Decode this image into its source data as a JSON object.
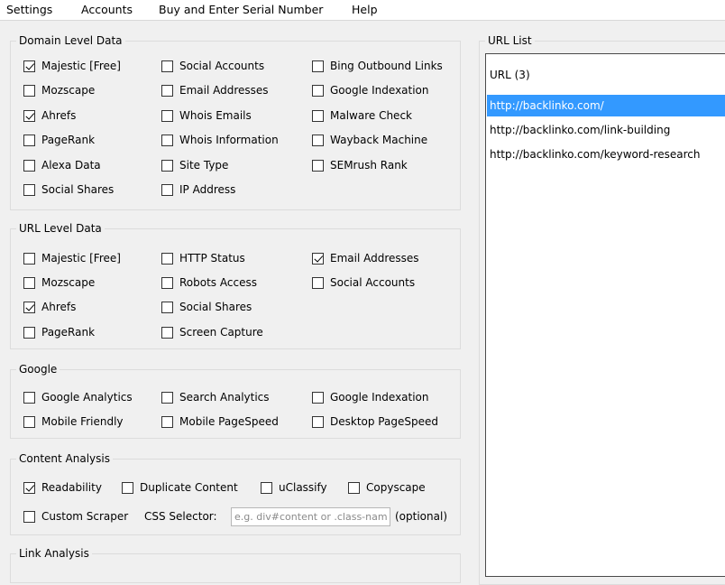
{
  "menu": [
    "Settings",
    "Accounts",
    "Buy and Enter Serial Number",
    "Help"
  ],
  "domain_level": {
    "title": "Domain Level Data",
    "options": [
      {
        "label": "Majestic [Free]",
        "checked": true
      },
      {
        "label": "Mozscape",
        "checked": false
      },
      {
        "label": "Ahrefs",
        "checked": true
      },
      {
        "label": "PageRank",
        "checked": false
      },
      {
        "label": "Alexa Data",
        "checked": false
      },
      {
        "label": "Social Shares",
        "checked": false
      },
      {
        "label": "Social Accounts",
        "checked": false
      },
      {
        "label": "Email Addresses",
        "checked": false
      },
      {
        "label": "Whois Emails",
        "checked": false
      },
      {
        "label": "Whois Information",
        "checked": false
      },
      {
        "label": "Site Type",
        "checked": false
      },
      {
        "label": "IP Address",
        "checked": false
      },
      {
        "label": "Bing Outbound Links",
        "checked": false
      },
      {
        "label": "Google Indexation",
        "checked": false
      },
      {
        "label": "Malware Check",
        "checked": false
      },
      {
        "label": "Wayback Machine",
        "checked": false
      },
      {
        "label": "SEMrush Rank",
        "checked": false
      }
    ]
  },
  "url_level": {
    "title": "URL Level Data",
    "options": [
      {
        "label": "Majestic [Free]",
        "checked": false
      },
      {
        "label": "Mozscape",
        "checked": false
      },
      {
        "label": "Ahrefs",
        "checked": true
      },
      {
        "label": "PageRank",
        "checked": false
      },
      {
        "label": "HTTP Status",
        "checked": false
      },
      {
        "label": "Robots Access",
        "checked": false
      },
      {
        "label": "Social Shares",
        "checked": false
      },
      {
        "label": "Screen Capture",
        "checked": false
      },
      {
        "label": "Email Addresses",
        "checked": true
      },
      {
        "label": "Social Accounts",
        "checked": false
      }
    ]
  },
  "google": {
    "title": "Google",
    "options": [
      {
        "label": "Google Analytics",
        "checked": false
      },
      {
        "label": "Mobile Friendly",
        "checked": false
      },
      {
        "label": "Search Analytics",
        "checked": false
      },
      {
        "label": "Mobile PageSpeed",
        "checked": false
      },
      {
        "label": "Google Indexation",
        "checked": false
      },
      {
        "label": "Desktop PageSpeed",
        "checked": false
      }
    ]
  },
  "content_analysis": {
    "title": "Content Analysis",
    "options": [
      {
        "label": "Readability",
        "checked": true
      },
      {
        "label": "Duplicate Content",
        "checked": false
      },
      {
        "label": "uClassify",
        "checked": false
      },
      {
        "label": "Copyscape",
        "checked": false
      },
      {
        "label": "Custom Scraper",
        "checked": false
      }
    ],
    "css_selector_label": "CSS Selector:",
    "css_selector_placeholder": "e.g. div#content or .class-name",
    "css_selector_value": "",
    "optional_label": "(optional)"
  },
  "link_analysis": {
    "title": "Link Analysis"
  },
  "url_list": {
    "title": "URL List",
    "header": "URL (3)",
    "selected_index": 0,
    "urls": [
      "http://backlinko.com/",
      "http://backlinko.com/link-building",
      "http://backlinko.com/keyword-research"
    ]
  }
}
